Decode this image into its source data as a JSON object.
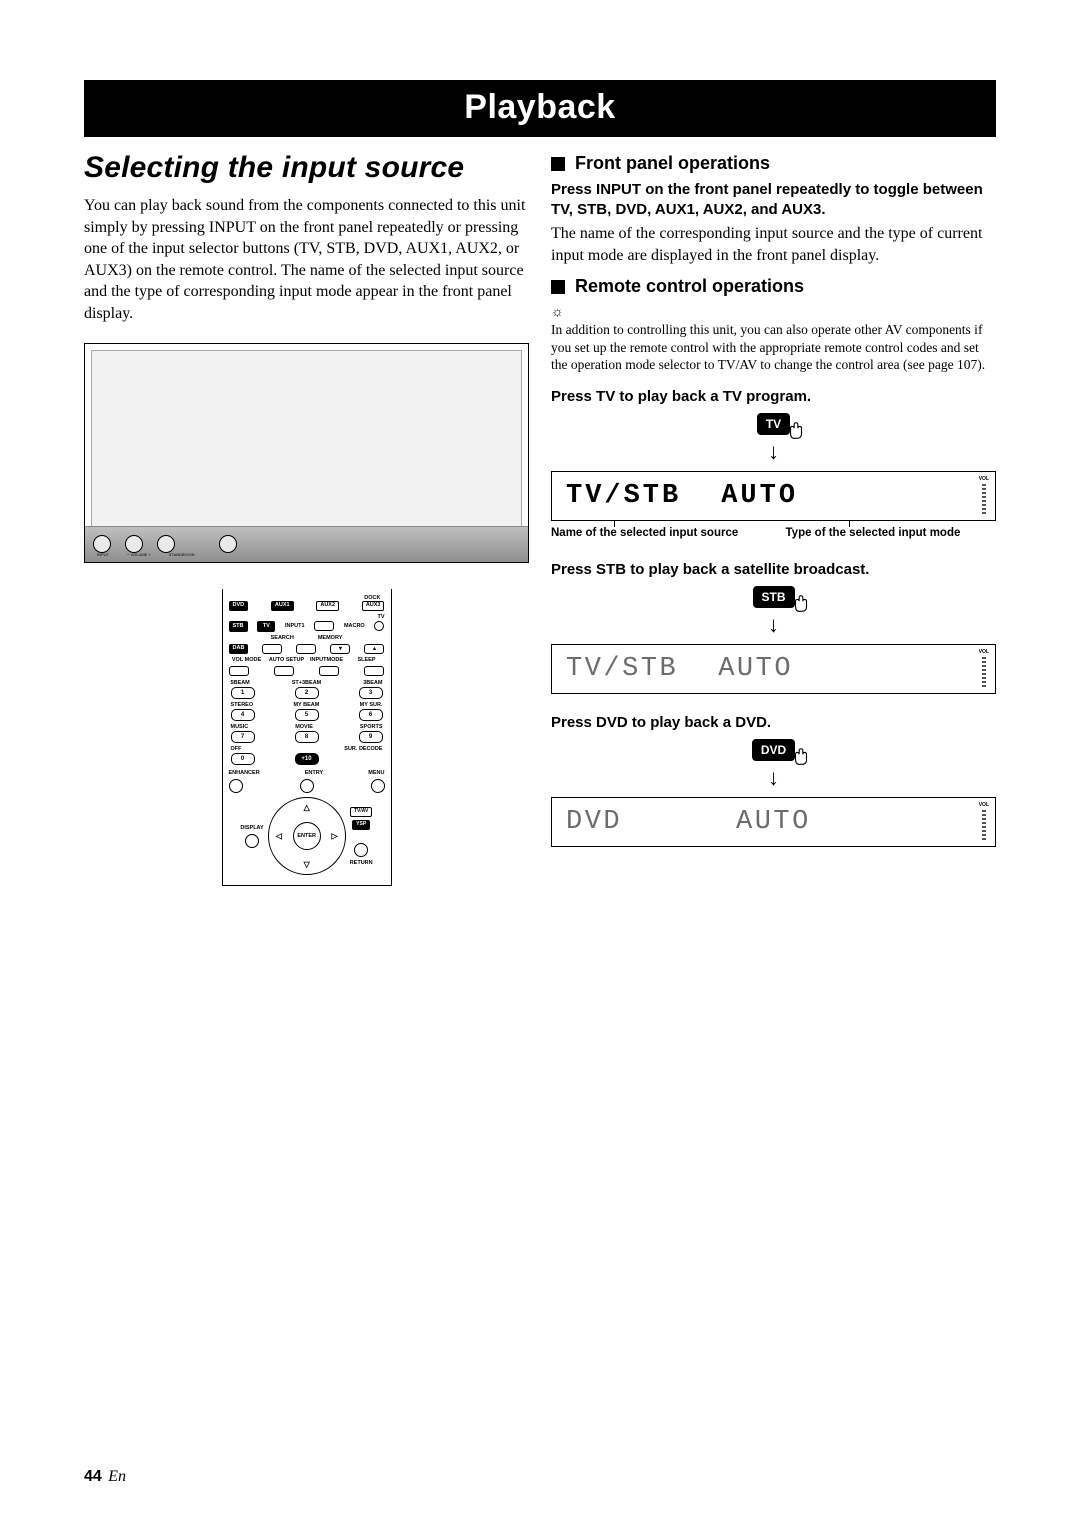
{
  "banner": "Playback",
  "left": {
    "title": "Selecting the input source",
    "intro": "You can play back sound from the components connected to this unit simply by pressing INPUT on the front panel repeatedly or pressing one of the input selector buttons (TV, STB, DVD, AUX1, AUX2, or AUX3) on the remote control. The name of the selected input source and the type of corresponding input mode appear in the front panel display.",
    "device_labels": {
      "input": "INPUT",
      "vol_minus": "−  VOLUME  +",
      "standby": "STANDBY/ON"
    }
  },
  "remote": {
    "row1": [
      "DVD",
      "AUX1",
      "AUX2",
      "AUX3"
    ],
    "dock": "DOCK",
    "row2": [
      "STB",
      "TV"
    ],
    "input1": "INPUT1",
    "tv": "TV",
    "macro": "MACRO",
    "dab": "DAB",
    "search": "SEARCH",
    "memory": "MEMORY",
    "row_mode": [
      "VOL MODE",
      "AUTO SETUP",
      "INPUTMODE",
      "SLEEP"
    ],
    "num_labels_1": [
      "5BEAM",
      "ST+3BEAM",
      "3BEAM"
    ],
    "nums_1": [
      "1",
      "2",
      "3"
    ],
    "num_labels_2": [
      "STEREO",
      "MY BEAM",
      "MY SUR."
    ],
    "nums_2": [
      "4",
      "5",
      "6"
    ],
    "num_labels_3": [
      "MUSIC",
      "MOVIE",
      "SPORTS"
    ],
    "nums_3": [
      "7",
      "8",
      "9"
    ],
    "num_labels_4": [
      "OFF",
      "",
      "SUR. DECODE"
    ],
    "nums_4": [
      "0",
      "+10"
    ],
    "bottom_row": [
      "ENHANCER",
      "ENTRY",
      "MENU"
    ],
    "enter": "ENTER",
    "side_right": [
      "TV/AV",
      "YSP"
    ],
    "display": "DISPLAY",
    "return": "RETURN"
  },
  "right": {
    "sub1": "Front panel operations",
    "sub1_bold": "Press INPUT on the front panel repeatedly to toggle between TV, STB, DVD, AUX1, AUX2, and AUX3.",
    "sub1_body": "The name of the corresponding input source and the type of current input mode are displayed in the front panel display.",
    "sub2": "Remote control operations",
    "tip_icon": "☼",
    "sub2_note": "In addition to controlling this unit, you can also operate other AV components if you set up the remote control with the appropriate remote control codes and set the operation mode selector to TV/AV to change the control area (see page 107).",
    "ex1": {
      "press": "Press TV to play back a TV program.",
      "btn": "TV",
      "lcd_source": "TV/STB",
      "lcd_mode": "AUTO",
      "vol": "VOL",
      "cap1": "Name of the selected input source",
      "cap2": "Type of the selected input mode"
    },
    "ex2": {
      "press": "Press STB to play back a satellite broadcast.",
      "btn": "STB",
      "lcd_source": "TV/STB",
      "lcd_mode": "AUTO",
      "vol": "VOL"
    },
    "ex3": {
      "press": "Press DVD to play back a DVD.",
      "btn": "DVD",
      "lcd_source": "DVD",
      "lcd_mode": "AUTO",
      "vol": "VOL"
    }
  },
  "page": {
    "num": "44",
    "suffix": "En"
  }
}
